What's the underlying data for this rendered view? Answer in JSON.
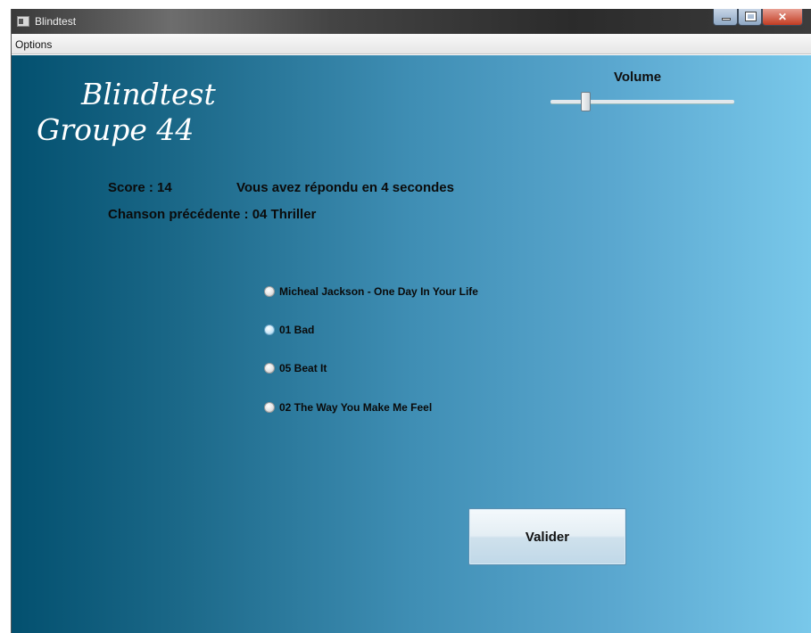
{
  "window": {
    "title": "Blindtest"
  },
  "menu": {
    "options_label": "Options"
  },
  "header": {
    "title_line1": "Blindtest",
    "title_line2": "Groupe 44"
  },
  "volume": {
    "label": "Volume",
    "level": 0.2
  },
  "stats": {
    "score": "Score : 14",
    "response_time": "Vous avez répondu en 4 secondes",
    "previous_song": "Chanson précédente : 04 Thriller"
  },
  "choices": [
    {
      "label": "Micheal Jackson - One Day In Your Life",
      "selected": false
    },
    {
      "label": "01 Bad",
      "selected": true
    },
    {
      "label": "05 Beat It",
      "selected": false
    },
    {
      "label": "02 The Way You Make Me Feel",
      "selected": false
    }
  ],
  "actions": {
    "validate_label": "Valider"
  },
  "colors": {
    "gradient_start": "#03506f",
    "gradient_end": "#79c8ea"
  }
}
